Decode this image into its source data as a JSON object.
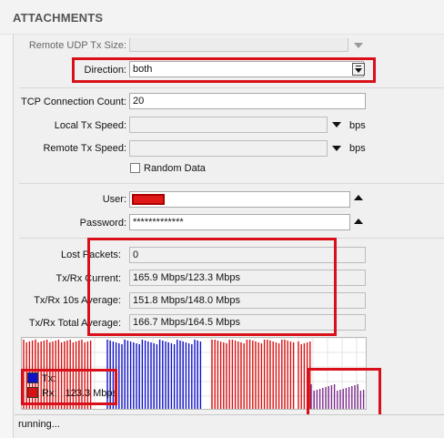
{
  "header": {
    "title": "ATTACHMENTS"
  },
  "form": {
    "remote_udp_tx_size": {
      "label": "Remote UDP Tx Size:",
      "value": ""
    },
    "direction": {
      "label": "Direction:",
      "value": "both"
    },
    "tcp_connection_count": {
      "label": "TCP Connection Count:",
      "value": "20"
    },
    "local_tx_speed": {
      "label": "Local Tx Speed:",
      "value": "",
      "unit": "bps"
    },
    "remote_tx_speed": {
      "label": "Remote Tx Speed:",
      "value": "",
      "unit": "bps"
    },
    "random_data": {
      "label": "Random Data",
      "checked": false
    },
    "user": {
      "label": "User:",
      "value": ""
    },
    "password": {
      "label": "Password:",
      "value": "*************"
    }
  },
  "stats": {
    "lost_packets": {
      "label": "Lost Packets:",
      "value": "0"
    },
    "tx_rx_current": {
      "label": "Tx/Rx Current:",
      "value": "165.9 Mbps/123.3 Mbps"
    },
    "tx_rx_10s_average": {
      "label": "Tx/Rx 10s Average:",
      "value": "151.8 Mbps/148.0 Mbps"
    },
    "tx_rx_total_average": {
      "label": "Tx/Rx Total Average:",
      "value": "166.7 Mbps/164.5 Mbps"
    }
  },
  "graph": {
    "legend": [
      {
        "label": "Tx:",
        "value": "",
        "color": "#1010c8"
      },
      {
        "label": "Rx:",
        "value": "123.3 Mbps",
        "color": "#d81010"
      }
    ]
  },
  "status": {
    "text": "running..."
  },
  "colors": {
    "annotation": "#d9101a",
    "tx": "#1010c8",
    "rx": "#d81010",
    "overlap": "#7a2a8a"
  }
}
